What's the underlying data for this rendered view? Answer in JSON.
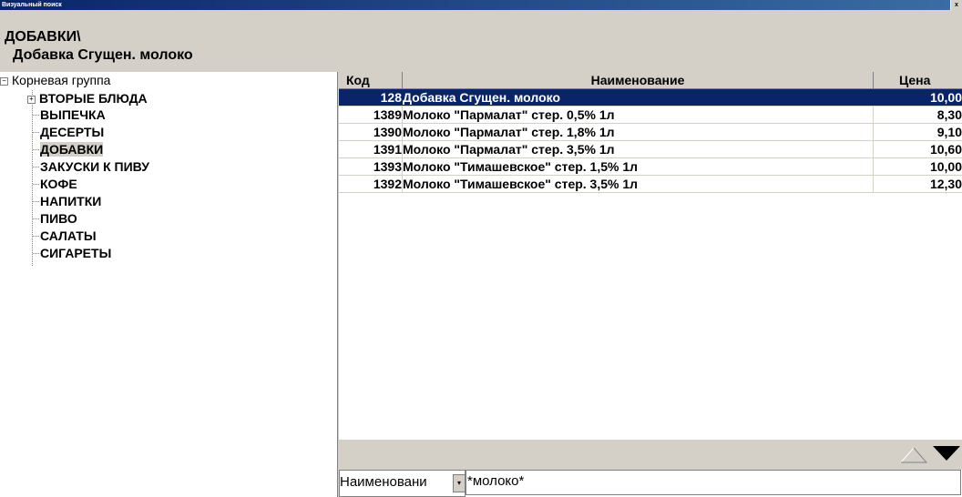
{
  "window": {
    "title": "Визуальный поиск",
    "close_glyph": "x"
  },
  "header": {
    "path": "ДОБАВКИ\\",
    "selected_item": "Добавка Сгущен. молоко"
  },
  "tree": {
    "root_label": "Корневая группа",
    "root_toggle": "−",
    "expandable": {
      "label": "ВТОРЫЕ БЛЮДА",
      "toggle": "+"
    },
    "items": [
      {
        "label": "ВЫПЕЧКА"
      },
      {
        "label": "ДЕСЕРТЫ"
      },
      {
        "label": "ДОБАВКИ"
      },
      {
        "label": "ЗАКУСКИ К ПИВУ"
      },
      {
        "label": "КОФЕ"
      },
      {
        "label": "НАПИТКИ"
      },
      {
        "label": "ПИВО"
      },
      {
        "label": "САЛАТЫ"
      },
      {
        "label": "СИГАРЕТЫ"
      }
    ],
    "active_item": "ДОБАВКИ"
  },
  "grid": {
    "columns": {
      "code": "Код",
      "name": "Наименование",
      "price": "Цена"
    },
    "rows": [
      {
        "code": "128",
        "name": "Добавка Сгущен. молоко",
        "price": "10,00",
        "selected": true
      },
      {
        "code": "1389",
        "name": "Молоко \"Пармалат\" стер. 0,5% 1л",
        "price": "8,30",
        "selected": false
      },
      {
        "code": "1390",
        "name": "Молоко \"Пармалат\" стер. 1,8% 1л",
        "price": "9,10",
        "selected": false
      },
      {
        "code": "1391",
        "name": "Молоко \"Пармалат\" стер. 3,5% 1л",
        "price": "10,60",
        "selected": false
      },
      {
        "code": "1393",
        "name": "Молоко \"Тимашевское\" стер. 1,5% 1л",
        "price": "10,00",
        "selected": false
      },
      {
        "code": "1392",
        "name": "Молоко \"Тимашевское\" стер. 3,5% 1л",
        "price": "12,30",
        "selected": false
      }
    ]
  },
  "navigation": {
    "up_icon": "triangle-up-icon",
    "down_icon": "triangle-down-icon"
  },
  "search": {
    "field_value": "Наименовани",
    "dropdown_glyph": "▾",
    "query": "*молоко*"
  },
  "colors": {
    "selection": "#0a246a",
    "background": "#d4d0c8"
  }
}
